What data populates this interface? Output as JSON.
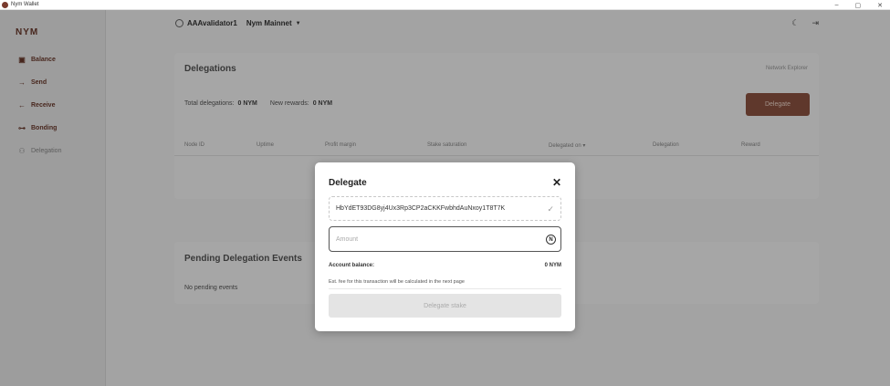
{
  "window": {
    "title": "Nym Wallet",
    "controls": [
      "–",
      "▢",
      "✕"
    ]
  },
  "sidebar": {
    "logo": "NYM",
    "items": [
      {
        "label": "Balance",
        "icon": "wallet-icon",
        "glyph": "▣"
      },
      {
        "label": "Send",
        "icon": "arrow-right-icon",
        "glyph": "→"
      },
      {
        "label": "Receive",
        "icon": "arrow-left-icon",
        "glyph": "←"
      },
      {
        "label": "Bonding",
        "icon": "bond-icon",
        "glyph": "⊶"
      },
      {
        "label": "Delegation",
        "icon": "delegation-icon",
        "glyph": "⚇"
      }
    ]
  },
  "header": {
    "account": "AAAvalidator1",
    "network": "Nym Mainnet",
    "theme_icon": "☾",
    "logout_icon": "⇥"
  },
  "delegations": {
    "title": "Delegations",
    "explorer_link": "Network Explorer",
    "total_label": "Total delegations:",
    "total_value": "0 NYM",
    "rewards_label": "New rewards:",
    "rewards_value": "0 NYM",
    "delegate_button": "Delegate",
    "columns": [
      "Node ID",
      "Uptime",
      "Profit margin",
      "Stake saturation",
      "Delegated on ▾",
      "Delegation",
      "Reward"
    ]
  },
  "pending": {
    "title": "Pending Delegation Events",
    "empty": "No pending events"
  },
  "modal": {
    "title": "Delegate",
    "close": "✕",
    "address": "HbYdET93DG8yj4Ux3Rp3CP2aCKKFwbhdAuNxoy1T8T7K",
    "amount_placeholder": "Amount",
    "amount_value": "",
    "balance_label": "Account balance:",
    "balance_value": "0 NYM",
    "fee_note": "Est. fee for this transaction will be calculated in the next page",
    "submit": "Delegate stake"
  }
}
